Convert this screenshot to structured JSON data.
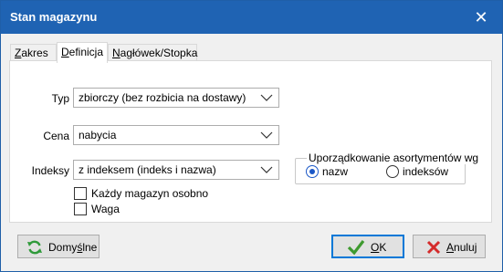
{
  "window": {
    "title": "Stan magazynu",
    "close_glyph": "✕"
  },
  "tabs": [
    {
      "label": "Zakres",
      "active": false
    },
    {
      "label": "Definicja",
      "active": true
    },
    {
      "label": "Nagłówek/Stopka",
      "active": false
    }
  ],
  "form": {
    "typ_label": "Typ",
    "typ_value": "zbiorczy (bez rozbicia na dostawy)",
    "cena_label": "Cena",
    "cena_value": "nabycia",
    "indeksy_label": "Indeksy",
    "indeksy_value": "z indeksem (indeks i nazwa)",
    "kazdy_magazyn_label": "Każdy magazyn osobno",
    "kazdy_magazyn_checked": false,
    "waga_label": "Waga",
    "waga_checked": false
  },
  "sort_group": {
    "title": "Uporządkowanie asortymentów wg",
    "options": [
      {
        "label": "nazw",
        "selected": true
      },
      {
        "label": "indeksów",
        "selected": false
      }
    ]
  },
  "buttons": {
    "defaults_label": "Domyślne",
    "ok_label": "OK",
    "cancel_label": "Anuluj"
  },
  "colors": {
    "titlebar": "#1f63b3",
    "ok_check": "#3e9a2f",
    "cancel_x": "#d42b2b",
    "refresh": "#2f9a3a",
    "radio_selected": "#1a57c7"
  },
  "icons": {
    "close": "close-icon",
    "dropdown": "chevron-down-icon",
    "defaults": "refresh-icon",
    "ok": "checkmark-icon",
    "cancel": "cross-icon"
  }
}
